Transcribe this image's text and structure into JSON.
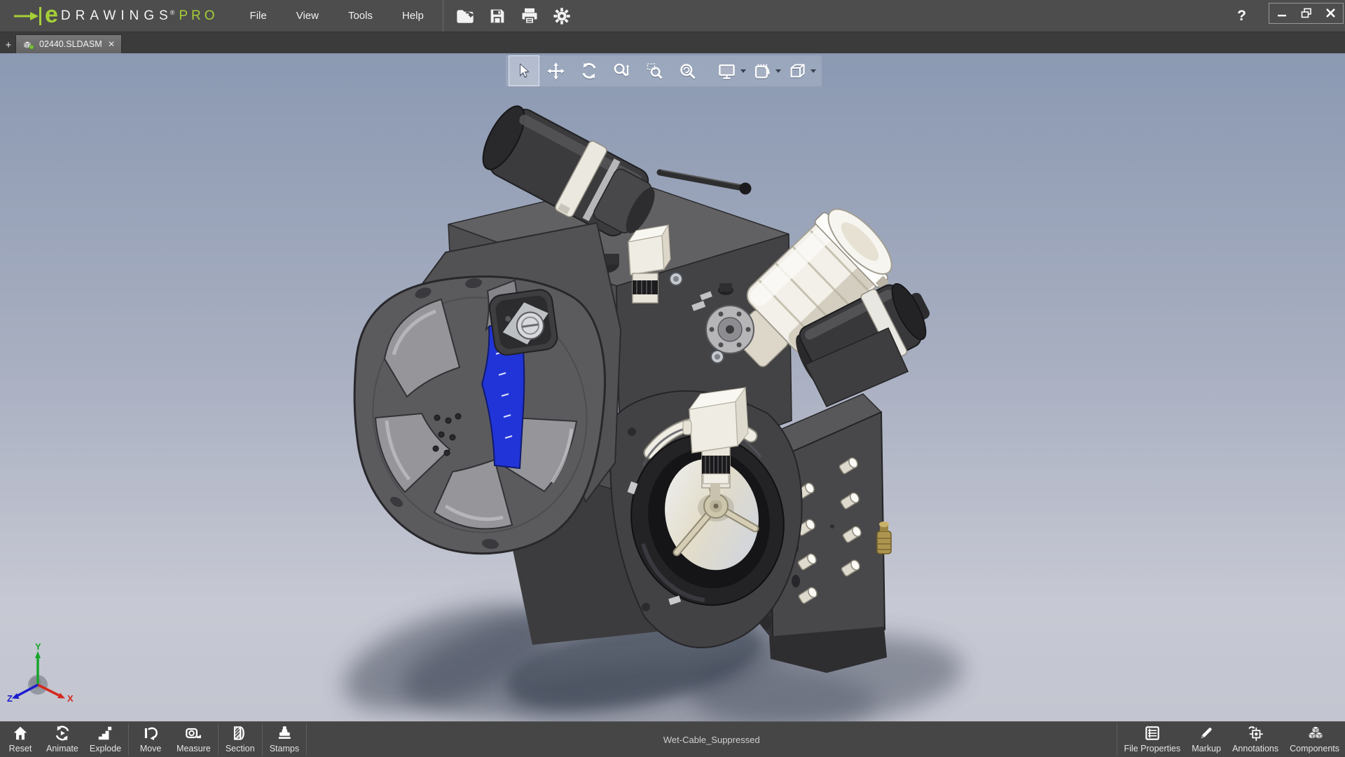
{
  "titlebar": {
    "brand": {
      "e": "e",
      "name": "DRAWINGS",
      "reg": "®",
      "tier": "PRO"
    },
    "menu": [
      "File",
      "View",
      "Tools",
      "Help"
    ],
    "help": "?",
    "quickbar_icons": [
      "open-file-icon",
      "save-icon",
      "print-icon",
      "options-gear-icon"
    ],
    "window_icons": [
      "minimize-icon",
      "restore-icon",
      "close-icon"
    ]
  },
  "tabbar": {
    "new_tab": "+",
    "tab": {
      "label": "02440.SLDASM",
      "close": "✕",
      "active": true,
      "icon": "assembly-document-icon"
    }
  },
  "view_toolbar": {
    "tools": [
      {
        "name": "select",
        "icon": "cursor-icon",
        "active": true
      },
      {
        "name": "pan",
        "icon": "pan-arrows-icon"
      },
      {
        "name": "rotate",
        "icon": "rotate-arrows-icon"
      },
      {
        "name": "zoom-in-out",
        "icon": "magnifier-updown-icon"
      },
      {
        "name": "zoom-area",
        "icon": "magnifier-area-icon"
      },
      {
        "name": "zoom-fit",
        "icon": "magnifier-fit-icon"
      },
      {
        "name": "display-mode",
        "icon": "monitor-icon",
        "has_dropdown": true
      },
      {
        "name": "model-views",
        "icon": "views-notebook-icon",
        "has_dropdown": true
      },
      {
        "name": "orientation",
        "icon": "wireframe-cube-icon",
        "has_dropdown": true
      }
    ]
  },
  "viewport": {
    "axis": {
      "x": "X",
      "y": "Y",
      "z": "Z"
    },
    "model": "3D CAD assembly"
  },
  "statusbar": {
    "status_text": "Wet-Cable_Suppressed",
    "left_tools": [
      {
        "label": "Reset",
        "icon": "home-icon"
      },
      {
        "label": "Animate",
        "icon": "animate-icon"
      },
      {
        "label": "Explode",
        "icon": "explode-icon"
      },
      {
        "label": "Move",
        "icon": "move-component-icon"
      },
      {
        "label": "Measure",
        "icon": "measure-tape-icon"
      },
      {
        "label": "Section",
        "icon": "section-cut-icon"
      },
      {
        "label": "Stamps",
        "icon": "stamp-icon"
      }
    ],
    "right_tools": [
      {
        "label": "File Properties",
        "icon": "file-properties-icon"
      },
      {
        "label": "Markup",
        "icon": "markup-pencil-icon"
      },
      {
        "label": "Annotations",
        "icon": "annotations-icon"
      },
      {
        "label": "Components",
        "icon": "components-icon"
      }
    ]
  },
  "colors": {
    "accent_green": "#a5cf37",
    "titlebar_bg": "#4d4d4d",
    "viewport_top": "#8b99b2",
    "viewport_bottom": "#c6c8d3",
    "model_blue": "#2134d8",
    "axis_x": "#d42a1e",
    "axis_y": "#18a52c",
    "axis_z": "#1c1ccd"
  }
}
